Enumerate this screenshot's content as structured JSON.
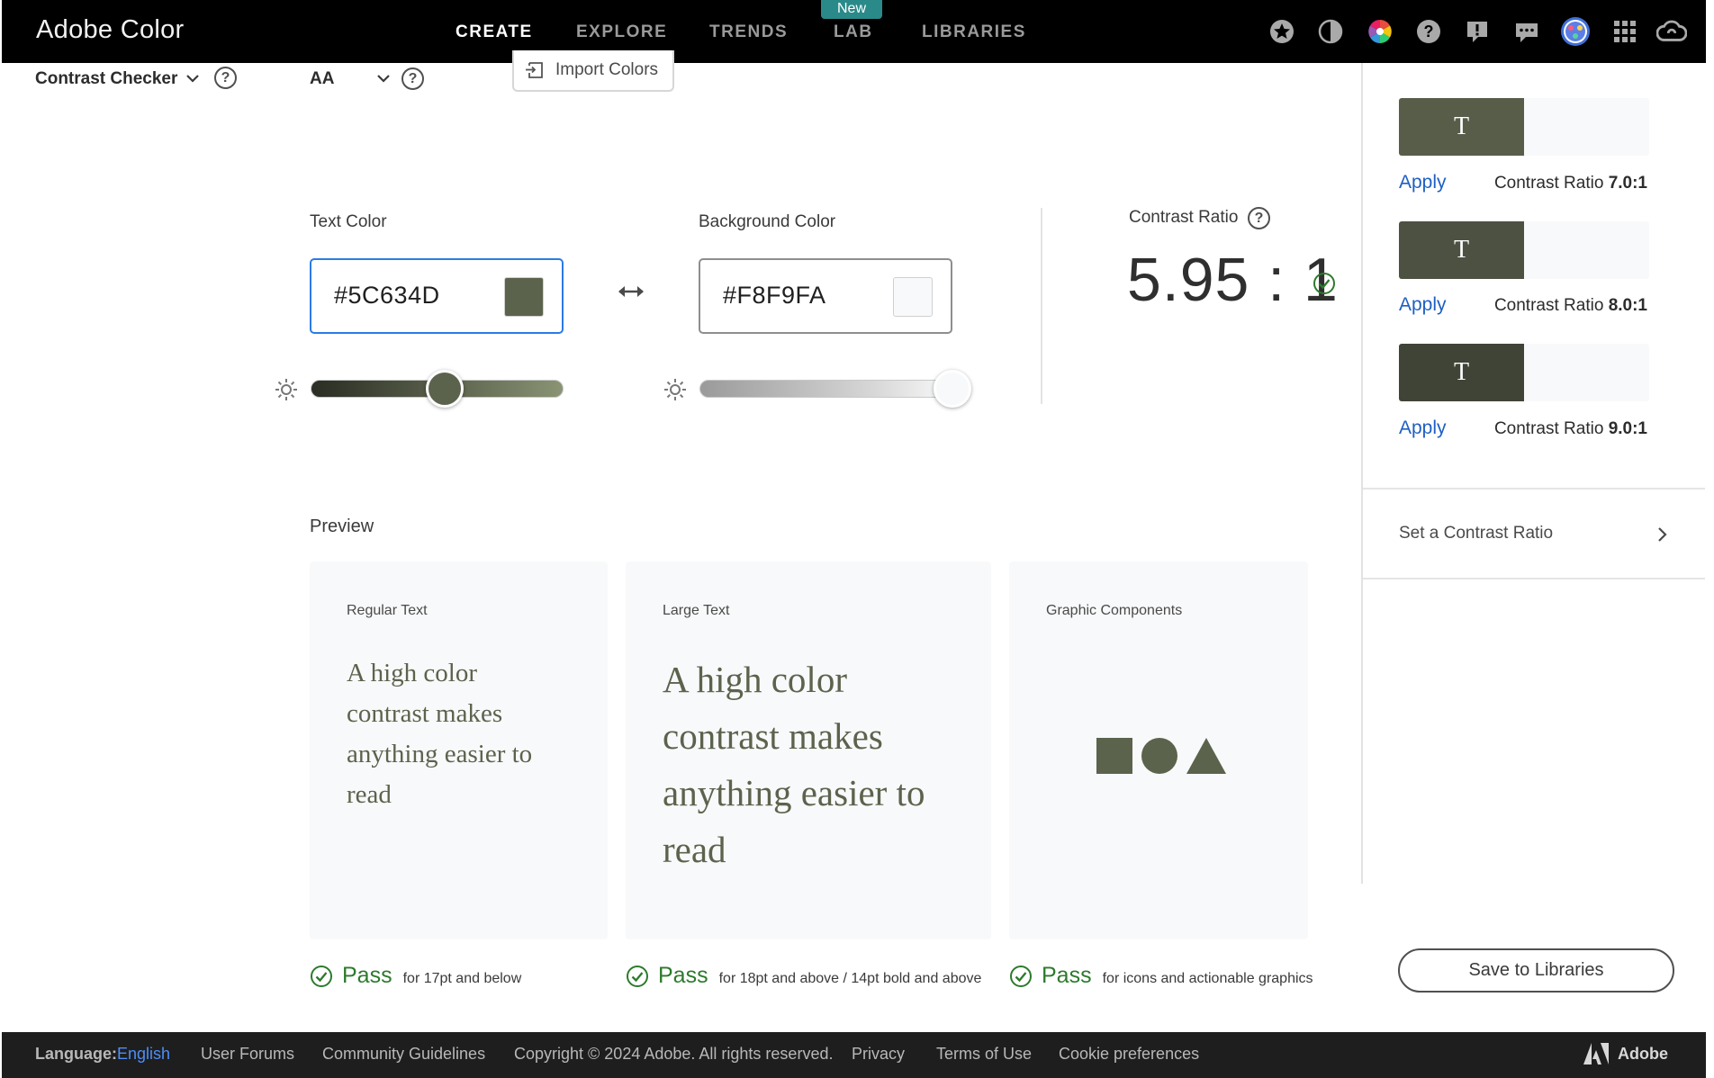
{
  "header": {
    "brand": "Adobe Color",
    "nav": [
      {
        "label": "CREATE",
        "active": true
      },
      {
        "label": "EXPLORE",
        "active": false
      },
      {
        "label": "TRENDS",
        "active": false
      },
      {
        "label": "LAB",
        "active": false
      },
      {
        "label": "LIBRARIES",
        "active": false
      }
    ],
    "lab_badge": "New",
    "icons": [
      "favorites-icon",
      "theme-toggle-icon",
      "color-wheel-icon",
      "help-icon",
      "feedback-icon",
      "chat-icon",
      "avatar",
      "apps-grid-icon",
      "creative-cloud-icon"
    ]
  },
  "toolbar": {
    "tool_label": "Contrast Checker",
    "level_label": "AA",
    "import_label": "Import Colors",
    "help_glyph": "?"
  },
  "checker": {
    "text_color_label": "Text Color",
    "text_color_value": "#5C634D",
    "background_color_label": "Background Color",
    "background_color_value": "#F8F9FA",
    "text_slider_level": 0.53,
    "background_slider_level": 1.0,
    "contrast_ratio_label": "Contrast Ratio",
    "contrast_ratio_value": "5.95 : 1"
  },
  "preview": {
    "title": "Preview",
    "cards": [
      {
        "title": "Regular Text",
        "text": "A high color contrast makes anything easier to read",
        "pass_word": "Pass",
        "pass_desc": "for 17pt and below"
      },
      {
        "title": "Large Text",
        "text": "A high color contrast makes anything easier to read",
        "pass_word": "Pass",
        "pass_desc": "for 18pt and above / 14pt bold and above"
      },
      {
        "title": "Graphic Components",
        "pass_word": "Pass",
        "pass_desc": "for icons and actionable graphics"
      }
    ]
  },
  "suggestions": {
    "items": [
      {
        "glyph": "T",
        "apply_label": "Apply",
        "ratio_label": "Contrast Ratio",
        "ratio_value": "7.0:1",
        "color": "#575d49"
      },
      {
        "glyph": "T",
        "apply_label": "Apply",
        "ratio_label": "Contrast Ratio",
        "ratio_value": "8.0:1",
        "color": "#4c5141"
      },
      {
        "glyph": "T",
        "apply_label": "Apply",
        "ratio_label": "Contrast Ratio",
        "ratio_value": "9.0:1",
        "color": "#404436"
      }
    ],
    "set_ratio_label": "Set a Contrast Ratio",
    "save_label": "Save to Libraries"
  },
  "footer": {
    "language_label": "Language:",
    "language_value": "English",
    "links": [
      "User Forums",
      "Community Guidelines",
      "Copyright © 2024 Adobe. All rights reserved.",
      "Privacy",
      "Terms of Use",
      "Cookie preferences"
    ],
    "brand": "Adobe"
  },
  "colors": {
    "text_color": "#5C634D",
    "background_color": "#F8F9FA",
    "pass_green": "#2d7a2d",
    "link_blue": "#1e5fc2"
  }
}
